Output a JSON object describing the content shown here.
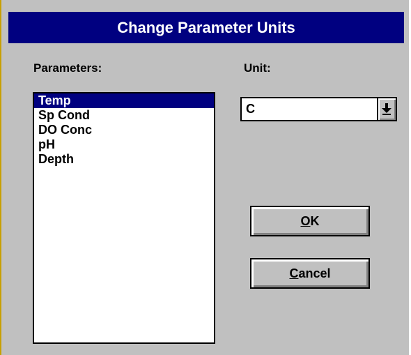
{
  "dialog": {
    "title": "Change Parameter Units"
  },
  "parameters": {
    "label": "Parameters:",
    "items": [
      "Temp",
      "Sp Cond",
      "DO Conc",
      "pH",
      "Depth"
    ],
    "selected": "Temp"
  },
  "unit": {
    "label": "Unit:",
    "selected_value": "C"
  },
  "buttons": {
    "ok_mnemonic": "O",
    "ok_rest": "K",
    "cancel_mnemonic": "C",
    "cancel_rest": "ancel"
  },
  "colors": {
    "titlebar": "#000080",
    "dialog_face": "#c0c0c0",
    "selection": "#000080"
  },
  "icons": {
    "dropdown": "chevron-down-icon"
  }
}
